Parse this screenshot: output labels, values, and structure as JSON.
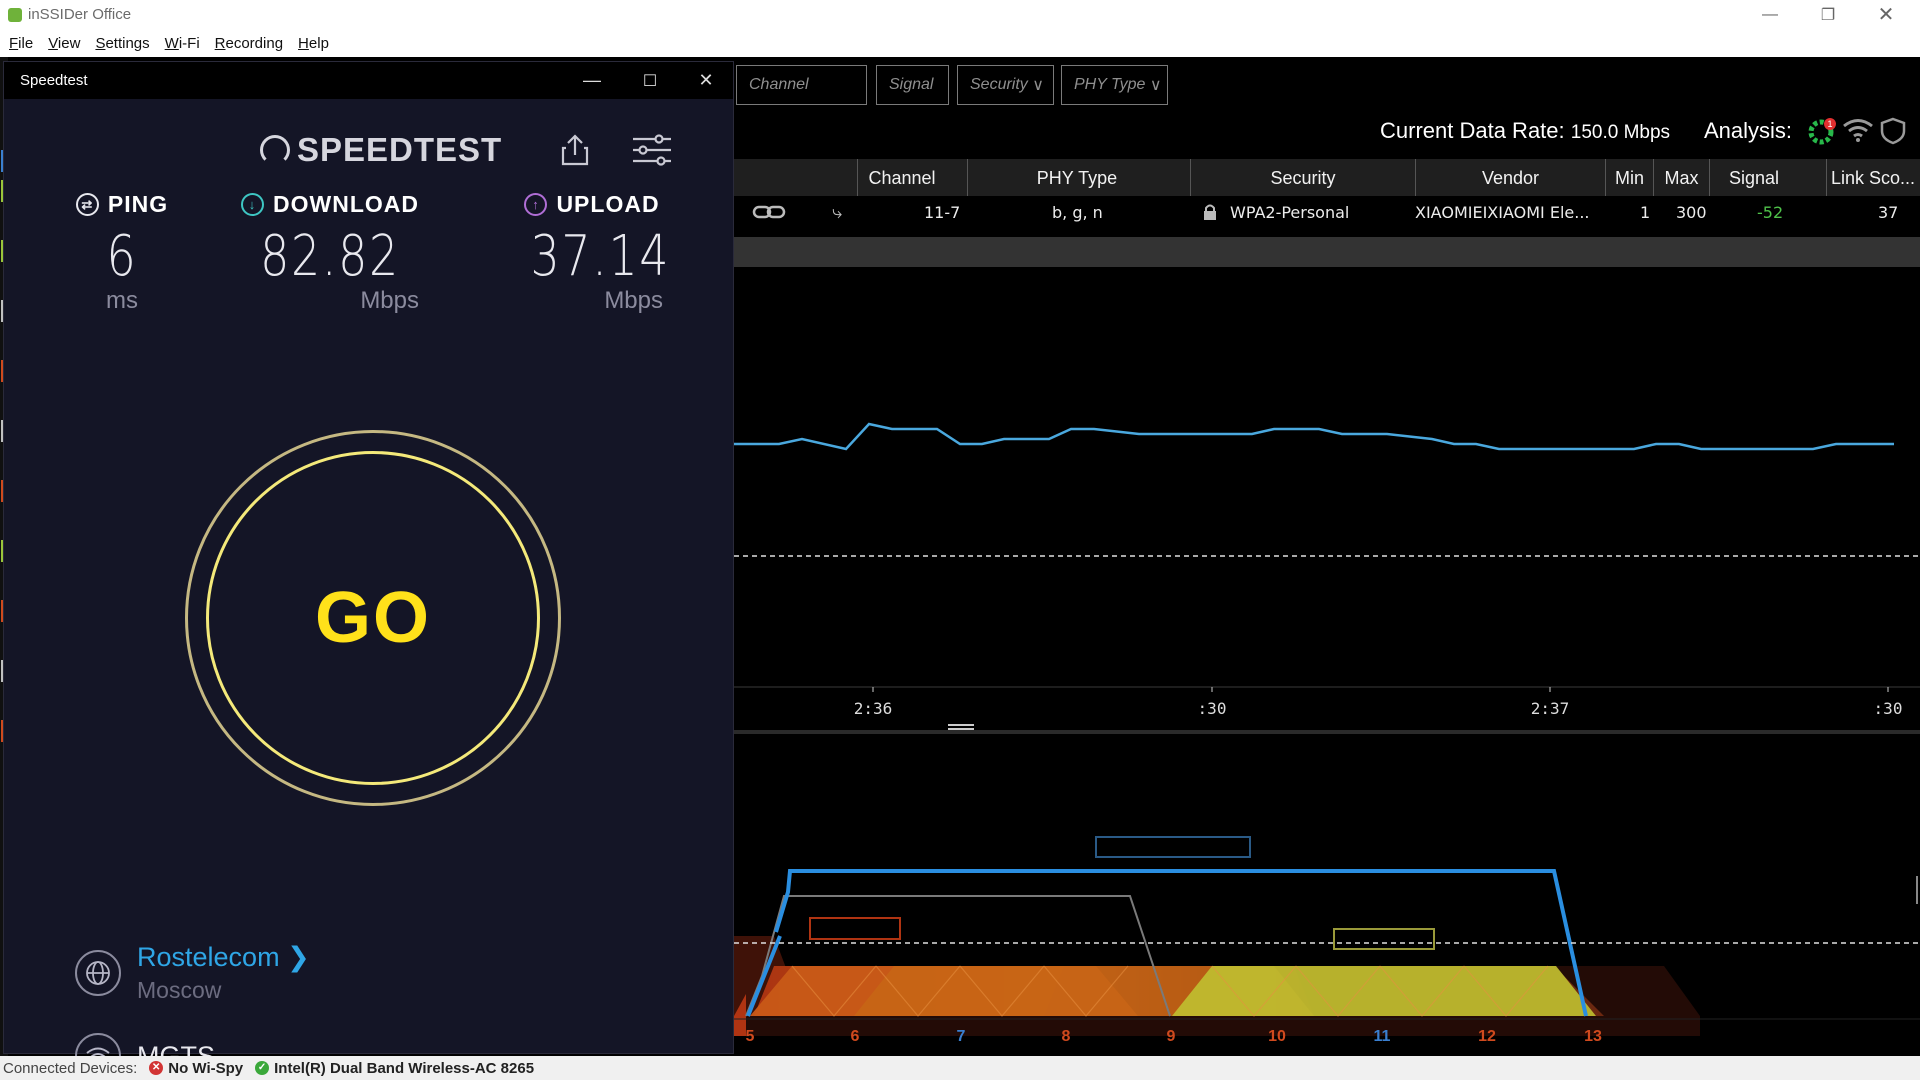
{
  "window": {
    "title": "inSSIDer Office",
    "menu": [
      "File",
      "View",
      "Settings",
      "Wi-Fi",
      "Recording",
      "Help"
    ]
  },
  "speedtest": {
    "window_title": "Speedtest",
    "logo_text": "SPEEDTEST",
    "ping": {
      "label": "PING",
      "value": "6",
      "unit": "ms"
    },
    "download": {
      "label": "DOWNLOAD",
      "value": "82.82",
      "unit": "Mbps"
    },
    "upload": {
      "label": "UPLOAD",
      "value": "37.14",
      "unit": "Mbps"
    },
    "go_label": "GO",
    "server": {
      "name": "Rostelecom",
      "city": "Moscow"
    },
    "isp": "MGTS"
  },
  "filters": {
    "channel_placeholder": "Channel",
    "signal_placeholder": "Signal",
    "security_label": "Security",
    "phy_label": "PHY Type"
  },
  "header_info": {
    "data_rate_label": "Current Data Rate:",
    "data_rate_value": "150.0 Mbps",
    "analysis_label": "Analysis:",
    "analysis_badge": "1"
  },
  "table": {
    "columns": [
      "Channel",
      "PHY Type",
      "Security",
      "Vendor",
      "Min",
      "Max",
      "Signal",
      "Link Sco..."
    ],
    "rows": [
      {
        "channel": "11-7",
        "phy": "b, g, n",
        "security": "WPA2-Personal",
        "vendor": "XIAOMIEIXIAOMI Ele...",
        "min": "1",
        "max": "300",
        "signal": "-52",
        "link_score": "37"
      }
    ]
  },
  "time_graph": {
    "x_ticks": [
      "2:36",
      ":30",
      "2:37",
      ":30"
    ],
    "line_color": "#4aa8de"
  },
  "spectrum": {
    "channels": [
      "5",
      "6",
      "7",
      "8",
      "9",
      "10",
      "11",
      "12",
      "13"
    ],
    "channel_colors": [
      "#d04a1e",
      "#d04a1e",
      "#3a7fd0",
      "#d04a1e",
      "#d04a1e",
      "#d04a1e",
      "#3a7fd0",
      "#d04a1e",
      "#d04a1e"
    ]
  },
  "status_bar": {
    "label": "Connected Devices:",
    "device1": "No Wi-Spy",
    "device2": "Intel(R) Dual Band Wireless-AC 8265"
  }
}
